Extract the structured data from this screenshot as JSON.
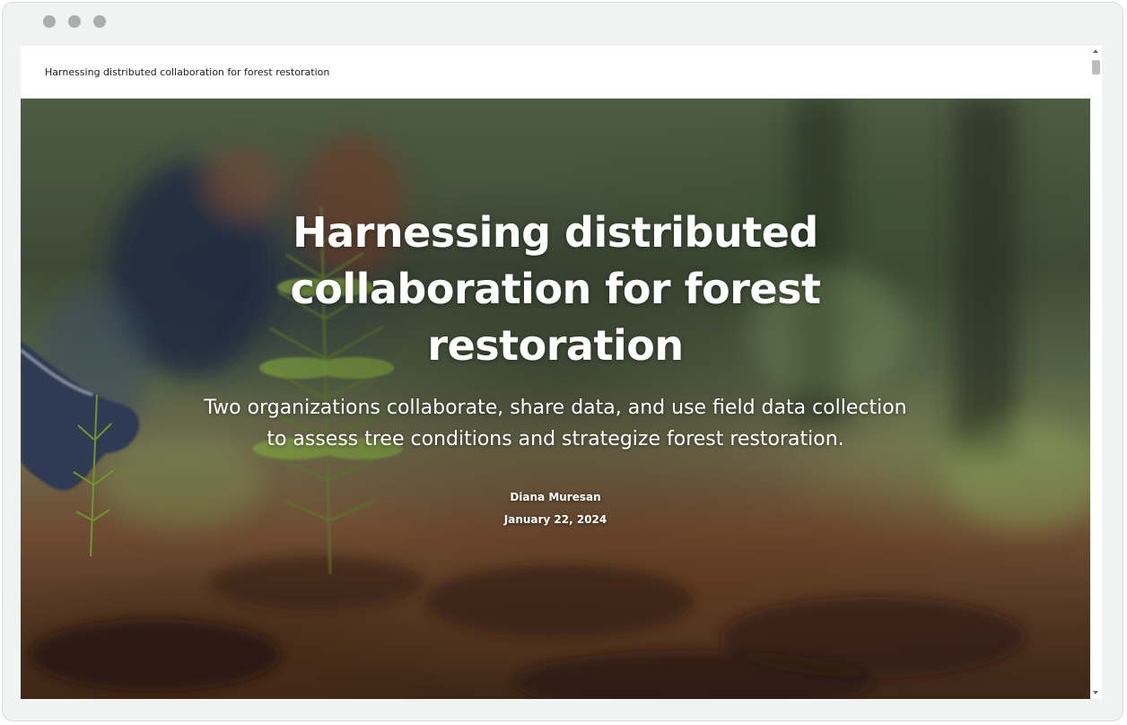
{
  "window": {
    "controls": [
      "window-dot-icon",
      "window-dot-icon",
      "window-dot-icon"
    ]
  },
  "header": {
    "title": "Harnessing distributed collaboration for forest restoration"
  },
  "hero": {
    "title": "Harnessing distributed collaboration for forest restoration",
    "subtitle": "Two organizations collaborate, share data, and use field data collection to assess tree conditions and strategize forest restoration.",
    "author": "Diana Muresan",
    "date": "January 22, 2024"
  },
  "colors": {
    "window_bg": "#f1f2f2",
    "header_bg": "#ffffff",
    "hero_text": "#ffffff",
    "soil": "#5a3a22",
    "foliage": "#6f8a4a"
  }
}
